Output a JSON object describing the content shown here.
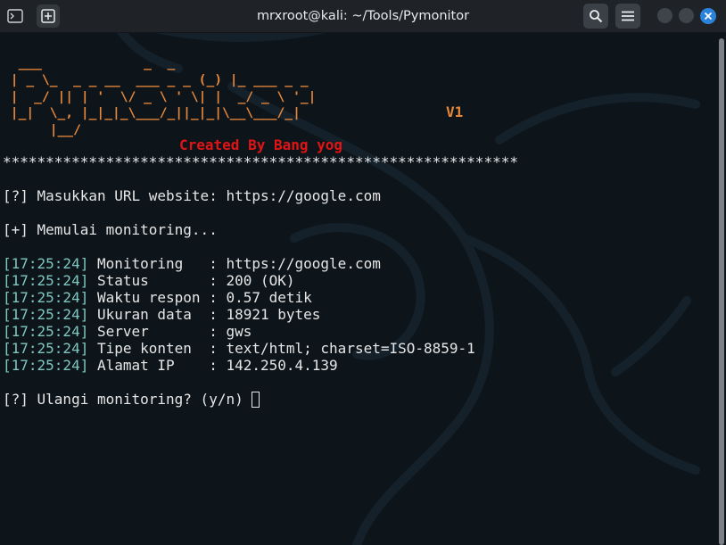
{
  "window": {
    "title": "mrxroot@kali: ~/Tools/Pymonitor",
    "icons": [
      "terminal-icon",
      "new-tab-icon",
      "search-icon",
      "menu-icon",
      "minimize-icon",
      "maximize-icon",
      "close-icon"
    ]
  },
  "terminal": {
    "banner_lines": [
      "  ___             _  _",
      " | _ \\_  _ _ __  ___ _ _ (_) |_ ___ _ _",
      " |  _/ || | '  \\/ _ \\ ' \\| |  _/ _ \\ '_|",
      " |_|  \\_, |_|_|_\\___/_||_|_|\\__\\___/_|",
      "      |__/"
    ],
    "version": "V1",
    "credit": "Created By Bang yog",
    "separator": "************************************************************",
    "url_prompt": "[?] Masukkan URL website: https://google.com",
    "start_msg": "[+] Memulai monitoring...",
    "log": [
      {
        "time": "[17:25:24]",
        "text": " Monitoring   : https://google.com"
      },
      {
        "time": "[17:25:24]",
        "text": " Status       : 200 (OK)"
      },
      {
        "time": "[17:25:24]",
        "text": " Waktu respon : 0.57 detik"
      },
      {
        "time": "[17:25:24]",
        "text": " Ukuran data  : 18921 bytes"
      },
      {
        "time": "[17:25:24]",
        "text": " Server       : gws"
      },
      {
        "time": "[17:25:24]",
        "text": " Tipe konten  : text/html; charset=ISO-8859-1"
      },
      {
        "time": "[17:25:24]",
        "text": " Alamat IP    : 142.250.4.139"
      }
    ],
    "repeat_prompt": "[?] Ulangi monitoring? (y/n) "
  },
  "colors": {
    "background": "#0d151b",
    "text": "#e6e6e6",
    "timestamp": "#7ec8c1",
    "banner": "#e8883a",
    "credit": "#e01414",
    "close_button": "#2a82da"
  }
}
